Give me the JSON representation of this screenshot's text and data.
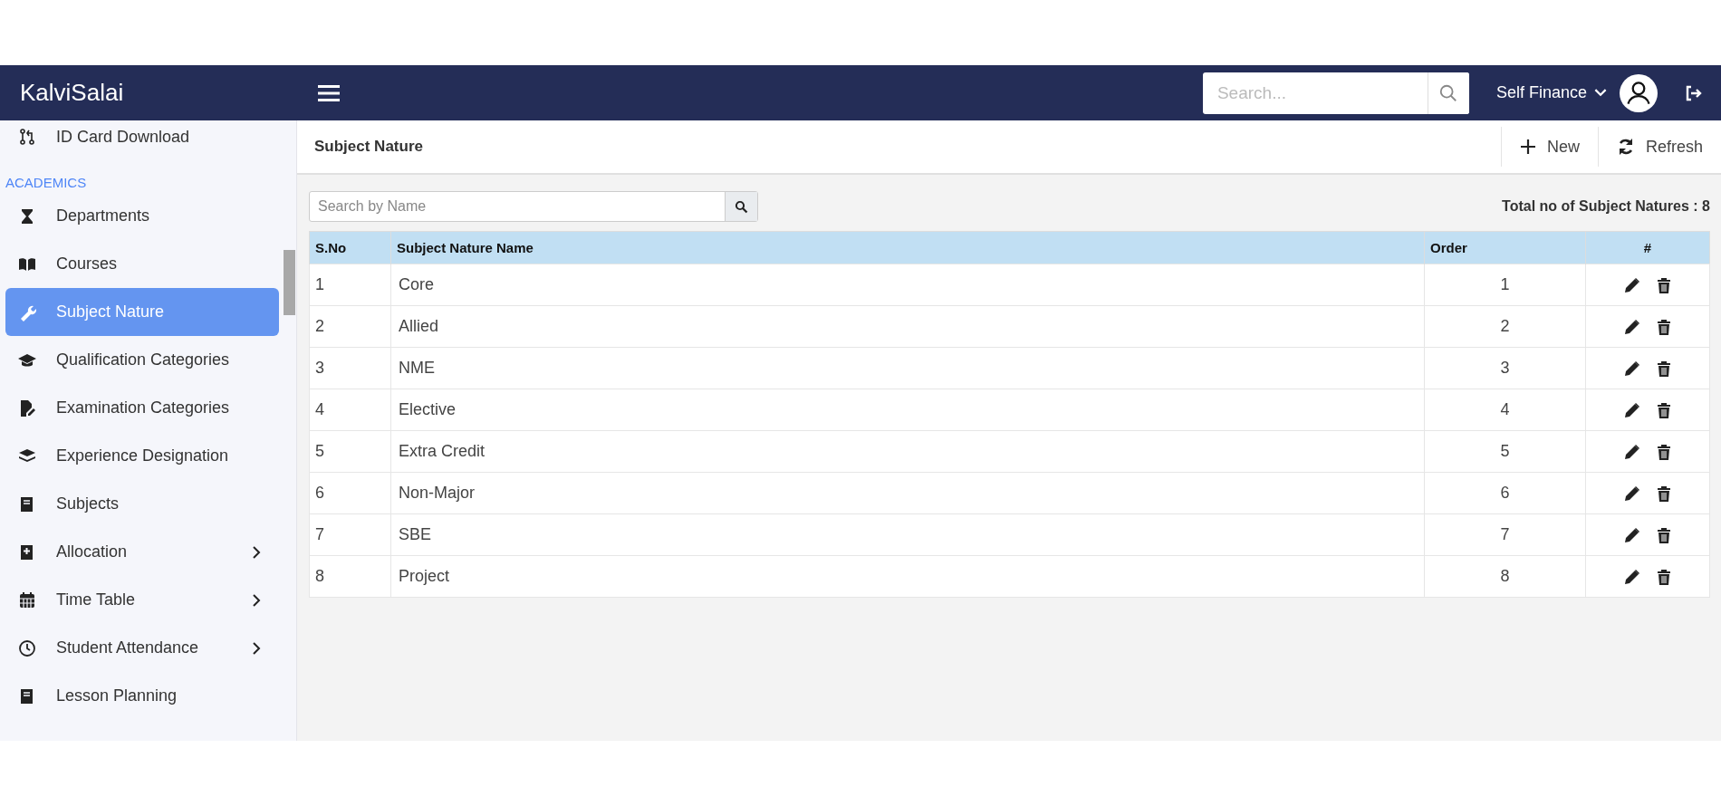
{
  "header": {
    "brand": "KalviSalai",
    "search": {
      "placeholder": "Search..."
    },
    "institution": "Self Finance"
  },
  "sidebar": {
    "items": [
      {
        "kind": "link",
        "label": "ID Card Download",
        "selected": false,
        "expandable": false
      },
      {
        "kind": "section",
        "label": "ACADEMICS"
      },
      {
        "kind": "link",
        "label": "Departments",
        "selected": false,
        "expandable": false
      },
      {
        "kind": "link",
        "label": "Courses",
        "selected": false,
        "expandable": false
      },
      {
        "kind": "link",
        "label": "Subject Nature",
        "selected": true,
        "expandable": false
      },
      {
        "kind": "link",
        "label": "Qualification Categories",
        "selected": false,
        "expandable": false
      },
      {
        "kind": "link",
        "label": "Examination Categories",
        "selected": false,
        "expandable": false
      },
      {
        "kind": "link",
        "label": "Experience Designation",
        "selected": false,
        "expandable": false
      },
      {
        "kind": "link",
        "label": "Subjects",
        "selected": false,
        "expandable": false
      },
      {
        "kind": "link",
        "label": "Allocation",
        "selected": false,
        "expandable": true
      },
      {
        "kind": "link",
        "label": "Time Table",
        "selected": false,
        "expandable": true
      },
      {
        "kind": "link",
        "label": "Student Attendance",
        "selected": false,
        "expandable": true
      },
      {
        "kind": "link",
        "label": "Lesson Planning",
        "selected": false,
        "expandable": false
      }
    ]
  },
  "page": {
    "title": "Subject Nature",
    "actions": [
      "New",
      "Refresh"
    ]
  },
  "filter": {
    "placeholder": "Search by Name"
  },
  "total": "Total no of Subject Natures : 8",
  "table": {
    "columns": [
      "S.No",
      "Subject Nature Name",
      "Order",
      "#"
    ],
    "rows": [
      {
        "sno": "1",
        "name": "Core",
        "order": "1"
      },
      {
        "sno": "2",
        "name": "Allied",
        "order": "2"
      },
      {
        "sno": "3",
        "name": "NME",
        "order": "3"
      },
      {
        "sno": "4",
        "name": "Elective",
        "order": "4"
      },
      {
        "sno": "5",
        "name": "Extra Credit",
        "order": "5"
      },
      {
        "sno": "6",
        "name": "Non-Major",
        "order": "6"
      },
      {
        "sno": "7",
        "name": "SBE",
        "order": "7"
      },
      {
        "sno": "8",
        "name": "Project",
        "order": "8"
      }
    ]
  }
}
